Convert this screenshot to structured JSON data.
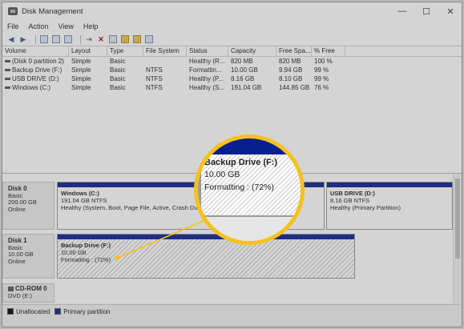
{
  "window": {
    "title": "Disk Management",
    "minimize": "—",
    "maximize": "☐",
    "close": "✕"
  },
  "menu": [
    "File",
    "Action",
    "View",
    "Help"
  ],
  "toolbar": {
    "icons": [
      "back-icon",
      "forward-icon",
      "properties-icon",
      "help-icon",
      "refresh-icon",
      "delete-icon",
      "check-icon",
      "folder-icon",
      "disk-icon",
      "settings-icon"
    ]
  },
  "volume_table": {
    "headers": [
      "Volume",
      "Layout",
      "Type",
      "File System",
      "Status",
      "Capacity",
      "Free Spa...",
      "% Free"
    ],
    "rows": [
      [
        "(Disk 0 partition 2)",
        "Simple",
        "Basic",
        "",
        "Healthy (R...",
        "820 MB",
        "820 MB",
        "100 %"
      ],
      [
        "Backup Drive (F:)",
        "Simple",
        "Basic",
        "NTFS",
        "Formattin...",
        "10.00 GB",
        "9.94 GB",
        "99 %"
      ],
      [
        "USB DRIVE (D:)",
        "Simple",
        "Basic",
        "NTFS",
        "Healthy (P...",
        "8.16 GB",
        "8.10 GB",
        "99 %"
      ],
      [
        "Windows (C:)",
        "Simple",
        "Basic",
        "NTFS",
        "Healthy (S...",
        "191.04 GB",
        "144.85 GB",
        "76 %"
      ]
    ]
  },
  "disks": {
    "disk0": {
      "name": "Disk 0",
      "type": "Basic",
      "size": "200.00 GB",
      "status": "Online",
      "windows": {
        "name": "Windows  (C:)",
        "info": "191.04 GB NTFS",
        "status": "Healthy (System, Boot, Page File, Active, Crash Dum"
      },
      "middle": {
        "status": "ery Partition)"
      },
      "usb": {
        "name": "USB DRIVE  (D:)",
        "info": "8.16 GB NTFS",
        "status": "Healthy (Primary Partition)"
      }
    },
    "disk1": {
      "name": "Disk 1",
      "type": "Basic",
      "size": "10.00 GB",
      "status": "Online",
      "backup": {
        "name": "Backup Drive  (F:)",
        "info": "10.00 GB",
        "status": "Formatting : (72%)"
      }
    },
    "cdrom": {
      "name": "CD-ROM 0",
      "drive": "DVD (E:)"
    }
  },
  "legend": {
    "unallocated": "Unallocated",
    "primary": "Primary partition",
    "unallocated_color": "#000000",
    "primary_color": "#0a1f8f"
  },
  "zoom": {
    "name": "Backup Drive  (F:)",
    "size": "10.00 GB",
    "status": "Formatting : (72%)"
  },
  "colors": {
    "highlight": "#f4c21a",
    "partition_bar": "#0a1f8f"
  }
}
